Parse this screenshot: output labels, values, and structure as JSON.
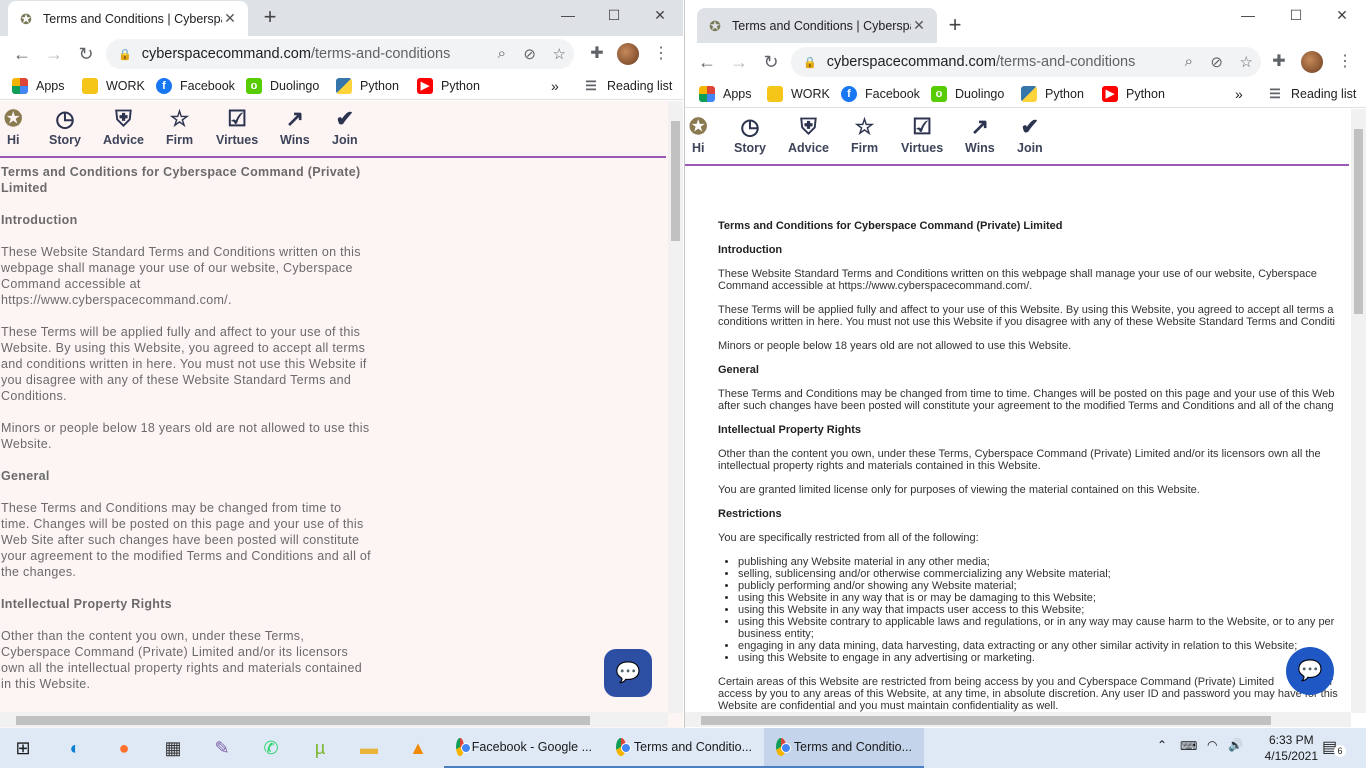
{
  "left_window": {
    "tab_title": "Terms and Conditions | Cyberspa",
    "url_host": "cyberspacecommand.com",
    "url_path": "/terms-and-conditions",
    "doc": {
      "heading": "Terms and Conditions for Cyberspace Command (Private) Limited",
      "intro_h": "Introduction",
      "p1": "These Website Standard Terms and Conditions written on this webpage shall manage your use of our website, Cyberspace Command accessible at https://www.cyberspacecommand.com/.",
      "p2": "These Terms will be applied fully and affect to your use of this Website. By using this Website, you agreed to accept all terms and conditions written in here. You must not use this Website if you disagree with any of these Website Standard Terms and Conditions.",
      "p3": "Minors or people below 18 years old are not allowed to use this Website.",
      "general_h": "General",
      "p4": "These Terms and Conditions may be changed from time to time. Changes will be posted on this page and your use of this Web Site after such changes have been posted will constitute your agreement to the modified Terms and Conditions and all of the changes.",
      "ip_h": "Intellectual Property Rights",
      "p5": "Other than the content you own, under these Terms, Cyberspace Command (Private) Limited and/or its licensors own all the intellectual property rights and materials contained in this Website."
    }
  },
  "right_window": {
    "tab_title": "Terms and Conditions | Cyberspa",
    "url_host": "cyberspacecommand.com",
    "url_path": "/terms-and-conditions",
    "doc": {
      "heading": "Terms and Conditions for Cyberspace Command (Private) Limited",
      "intro_h": "Introduction",
      "p1a": "These Website Standard Terms and Conditions written on this webpage shall manage your use of our website, Cyberspace",
      "p1b": "Command accessible at https://www.cyberspacecommand.com/.",
      "p2a": "These Terms will be applied fully and affect to your use of this Website. By using this Website, you agreed to accept all terms a",
      "p2b": "conditions written in here. You must not use this Website if you disagree with any of these Website Standard Terms and Conditi",
      "p3": "Minors or people below 18 years old are not allowed to use this Website.",
      "general_h": "General",
      "p4a": "These Terms and Conditions may be changed from time to time. Changes will be posted on this page and your use of this Web",
      "p4b": "after such changes have been posted will constitute your agreement to the modified Terms and Conditions and all of the chang",
      "ip_h": "Intellectual Property Rights",
      "p5a": "Other than the content you own, under these Terms, Cyberspace Command (Private) Limited and/or its licensors own all the",
      "p5b": "intellectual property rights and materials contained in this Website.",
      "p6": "You are granted limited license only for purposes of viewing the material contained on this Website.",
      "restrictions_h": "Restrictions",
      "p7": "You are specifically restricted from all of the following:",
      "list": [
        "publishing any Website material in any other media;",
        "selling, sublicensing and/or otherwise commercializing any Website material;",
        "publicly performing and/or showing any Website material;",
        "using this Website in any way that is or may be damaging to this Website;",
        "using this Website in any way that impacts user access to this Website;",
        "using this Website contrary to applicable laws and regulations, or in any way may cause harm to the Website, or to any per",
        "business entity;",
        "engaging in any data mining, data harvesting, data extracting or any other similar activity in relation to this Website;",
        "using this Website to engage in any advertising or marketing."
      ],
      "p8a": "Certain areas of this Website are restricted from being access by you and Cyberspace Command (Private) Limited",
      "p8a_tail": "her",
      "p8b": "access by you to any areas of this Website, at any time, in absolute discretion. Any user ID and password you may have for this",
      "p8c": "Website are confidential and you must maintain confidentiality as well."
    }
  },
  "bookmarks": [
    "Apps",
    "WORK",
    "Facebook",
    "Duolingo",
    "Python",
    "Python"
  ],
  "reading_list": "Reading list",
  "site_nav": [
    "Hi",
    "Story",
    "Advice",
    "Firm",
    "Virtues",
    "Wins",
    "Join"
  ],
  "taskbar": {
    "tasks": [
      "Facebook - Google ...",
      "Terms and Conditio...",
      "Terms and Conditio..."
    ],
    "time": "6:33 PM",
    "date": "4/15/2021",
    "notification_count": "6"
  },
  "icons": {
    "back": "arrow-left-icon",
    "forward": "arrow-right-icon",
    "reload": "reload-icon",
    "lock": "lock-icon",
    "zoom": "zoom-icon",
    "star": "star-icon",
    "extensions": "puzzle-icon"
  }
}
